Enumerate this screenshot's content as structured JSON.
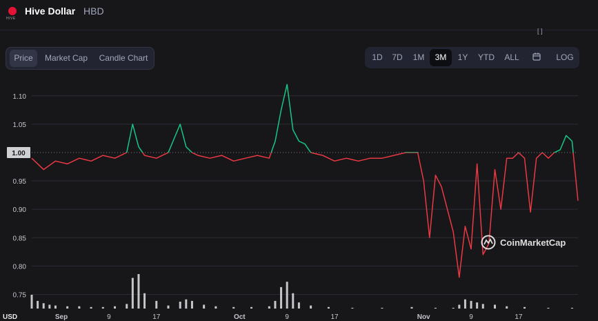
{
  "header": {
    "logo_text": "HIVE",
    "coin_name": "Hive Dollar",
    "coin_symbol": "HBD",
    "expand_icon": "expand-icon"
  },
  "view_tabs": [
    {
      "label": "Price",
      "active": true
    },
    {
      "label": "Market Cap",
      "active": false
    },
    {
      "label": "Candle Chart",
      "active": false
    }
  ],
  "ranges": [
    {
      "label": "1D",
      "active": false
    },
    {
      "label": "7D",
      "active": false
    },
    {
      "label": "1M",
      "active": false
    },
    {
      "label": "3M",
      "active": true
    },
    {
      "label": "1Y",
      "active": false
    },
    {
      "label": "YTD",
      "active": false
    },
    {
      "label": "ALL",
      "active": false
    }
  ],
  "calendar_icon": "calendar-icon",
  "log_label": "LOG",
  "watermark": "CoinMarketCap",
  "currency_label": "USD",
  "colors": {
    "up": "#16c784",
    "down": "#ea3943",
    "grid": "#2b2d36",
    "volume": "#d8d9dd",
    "text": "#c4c6cc"
  },
  "chart_data": {
    "type": "line",
    "baseline": 1.0,
    "baseline_label": "1.00",
    "y_ticks": [
      "1.10",
      "1.05",
      "1.00",
      "0.95",
      "0.90",
      "0.85",
      "0.80",
      "0.75"
    ],
    "ylim": [
      0.725,
      1.135
    ],
    "x_ticks": [
      "Sep",
      "9",
      "17",
      "Oct",
      "9",
      "17",
      "Nov",
      "9",
      "17"
    ],
    "xlim": [
      "2022-08-27",
      "2022-11-27"
    ],
    "grid": true,
    "series": [
      {
        "x": [
          "2022-08-27",
          "2022-08-29",
          "2022-08-31",
          "2022-09-02",
          "2022-09-04",
          "2022-09-06",
          "2022-09-08",
          "2022-09-10",
          "2022-09-12",
          "2022-09-13",
          "2022-09-14",
          "2022-09-15",
          "2022-09-17",
          "2022-09-19",
          "2022-09-21",
          "2022-09-22",
          "2022-09-23",
          "2022-09-24",
          "2022-09-26",
          "2022-09-28",
          "2022-09-30",
          "2022-10-02",
          "2022-10-04",
          "2022-10-06",
          "2022-10-07",
          "2022-10-08",
          "2022-10-09",
          "2022-10-10",
          "2022-10-11",
          "2022-10-12",
          "2022-10-13",
          "2022-10-15",
          "2022-10-17",
          "2022-10-19",
          "2022-10-21",
          "2022-10-23",
          "2022-10-25",
          "2022-10-27",
          "2022-10-29",
          "2022-10-31",
          "2022-11-01",
          "2022-11-02",
          "2022-11-03",
          "2022-11-04",
          "2022-11-05",
          "2022-11-06",
          "2022-11-07",
          "2022-11-08",
          "2022-11-09",
          "2022-11-10",
          "2022-11-11",
          "2022-11-12",
          "2022-11-13",
          "2022-11-14",
          "2022-11-15",
          "2022-11-16",
          "2022-11-17",
          "2022-11-18",
          "2022-11-19",
          "2022-11-20",
          "2022-11-21",
          "2022-11-22",
          "2022-11-23",
          "2022-11-24",
          "2022-11-25",
          "2022-11-26",
          "2022-11-27"
        ],
        "y": [
          0.99,
          0.97,
          0.985,
          0.98,
          0.99,
          0.985,
          0.995,
          0.99,
          1.0,
          1.05,
          1.01,
          0.995,
          0.99,
          1.0,
          1.05,
          1.01,
          1.0,
          0.995,
          0.99,
          0.995,
          0.985,
          0.99,
          0.995,
          0.99,
          1.02,
          1.075,
          1.12,
          1.04,
          1.02,
          1.015,
          1.0,
          0.995,
          0.985,
          0.99,
          0.985,
          0.99,
          0.99,
          0.995,
          1.0,
          1.0,
          0.95,
          0.85,
          0.96,
          0.94,
          0.9,
          0.86,
          0.78,
          0.87,
          0.83,
          0.98,
          0.82,
          0.84,
          0.97,
          0.9,
          0.99,
          0.99,
          1.0,
          0.99,
          0.895,
          0.99,
          1.0,
          0.99,
          1.0,
          1.005,
          1.03,
          1.02,
          0.915
        ]
      }
    ],
    "volume": {
      "x": [
        "2022-08-27",
        "2022-08-28",
        "2022-08-29",
        "2022-08-30",
        "2022-08-31",
        "2022-09-02",
        "2022-09-04",
        "2022-09-06",
        "2022-09-08",
        "2022-09-10",
        "2022-09-12",
        "2022-09-13",
        "2022-09-14",
        "2022-09-15",
        "2022-09-17",
        "2022-09-19",
        "2022-09-21",
        "2022-09-22",
        "2022-09-23",
        "2022-09-25",
        "2022-09-27",
        "2022-09-30",
        "2022-10-03",
        "2022-10-06",
        "2022-10-07",
        "2022-10-08",
        "2022-10-09",
        "2022-10-10",
        "2022-10-11",
        "2022-10-13",
        "2022-10-16",
        "2022-10-20",
        "2022-10-25",
        "2022-10-30",
        "2022-11-03",
        "2022-11-06",
        "2022-11-07",
        "2022-11-08",
        "2022-11-09",
        "2022-11-10",
        "2022-11-11",
        "2022-11-13",
        "2022-11-15",
        "2022-11-18",
        "2022-11-22",
        "2022-11-26"
      ],
      "values": [
        18,
        10,
        7,
        5,
        4,
        3,
        3,
        2,
        2,
        3,
        6,
        40,
        45,
        20,
        10,
        4,
        9,
        12,
        10,
        5,
        3,
        2,
        2,
        3,
        10,
        28,
        35,
        20,
        8,
        4,
        2,
        1,
        1,
        2,
        1,
        1,
        5,
        12,
        10,
        8,
        6,
        5,
        3,
        2,
        1,
        1
      ]
    }
  }
}
